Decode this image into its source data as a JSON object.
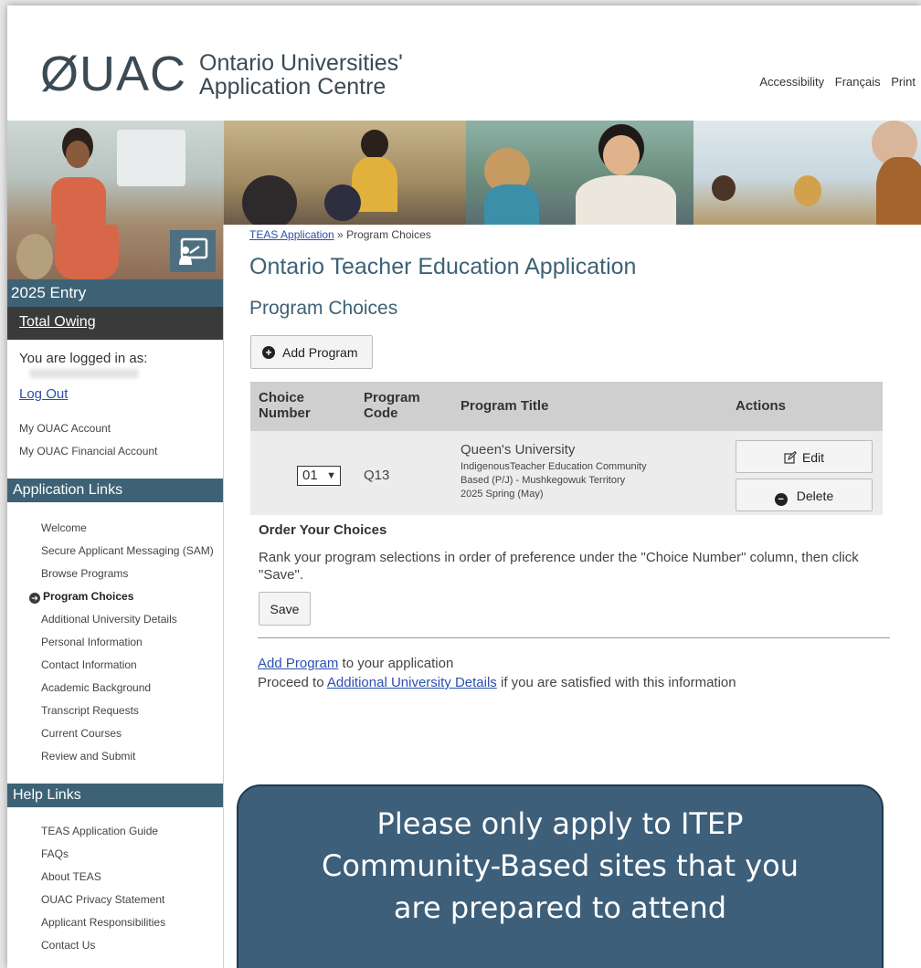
{
  "header": {
    "logo_mark": "ØUAC",
    "logo_line1": "Ontario Universities'",
    "logo_line2": "Application Centre",
    "links": [
      "Accessibility",
      "Français",
      "Print"
    ]
  },
  "sidebar": {
    "entry_label": "2025 Entry",
    "total_owing": "Total Owing",
    "logged_in": "You are logged in as:",
    "logout": "Log Out",
    "account_links": [
      "My OUAC Account",
      "My OUAC Financial Account"
    ],
    "app_links_heading": "Application Links",
    "app_links": [
      "Welcome",
      "Secure Applicant Messaging (SAM)",
      "Browse Programs",
      "Program Choices",
      "Additional University Details",
      "Personal Information",
      "Contact Information",
      "Academic Background",
      "Transcript Requests",
      "Current Courses",
      "Review and Submit"
    ],
    "active_link": "Program Choices",
    "help_heading": "Help Links",
    "help_links": [
      "TEAS Application Guide",
      "FAQs",
      "About TEAS",
      "OUAC Privacy Statement",
      "Applicant Responsibilities",
      "Contact Us"
    ]
  },
  "main": {
    "breadcrumb_link": "TEAS Application",
    "breadcrumb_sep": " » ",
    "breadcrumb_current": "Program Choices",
    "title": "Ontario Teacher Education Application",
    "subtitle": "Program Choices",
    "add_program_button": "Add Program",
    "table": {
      "headers": {
        "choice_number": [
          "Choice",
          "Number"
        ],
        "program_code": [
          "Program",
          "Code"
        ],
        "program_title": "Program Title",
        "actions": "Actions"
      },
      "rows": [
        {
          "choice": "01",
          "code": "Q13",
          "university": "Queen's University",
          "program_lines": [
            "IndigenousTeacher Education Community",
            "Based (P/J) - Mushkegowuk Territory",
            "2025 Spring (May)"
          ],
          "edit_label": "Edit",
          "delete_label": "Delete"
        }
      ]
    },
    "order_heading": "Order Your Choices",
    "order_text": "Rank your program selections in order of preference under the \"Choice Number\" column, then click \"Save\".",
    "save_button": "Save",
    "footer": {
      "add_link": "Add Program",
      "add_suffix": " to your application",
      "proceed_prefix": "Proceed to ",
      "proceed_link": "Additional University Details",
      "proceed_suffix": " if you are satisfied with this information"
    }
  },
  "callout": {
    "lines": [
      "Please only apply to ITEP",
      "Community-Based sites that you",
      "are prepared to attend"
    ]
  },
  "colors": {
    "accent": "#3d6275",
    "link": "#2a4fb0",
    "callout_bg": "#3d5f7a"
  }
}
